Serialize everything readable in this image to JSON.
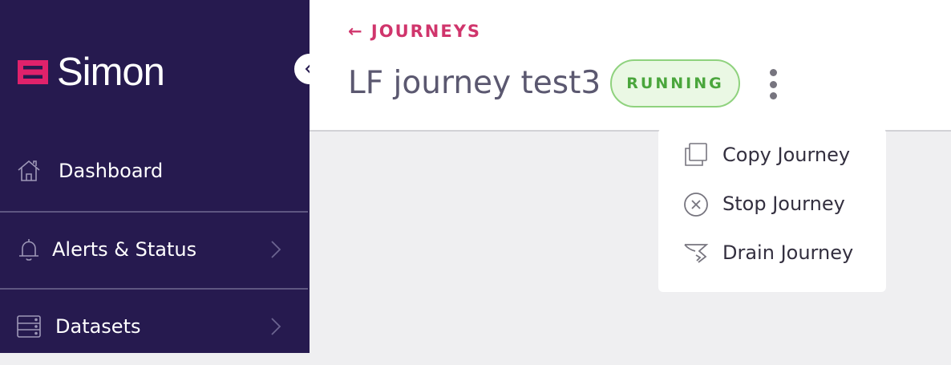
{
  "sidebar": {
    "brand": "Simon",
    "items": [
      {
        "label": "Dashboard",
        "icon": "home-icon"
      },
      {
        "label": "Alerts & Status",
        "icon": "bell-icon"
      },
      {
        "label": "Datasets",
        "icon": "database-icon"
      }
    ]
  },
  "header": {
    "back_link": "← JOURNEYS",
    "title": "LF journey test3",
    "status": "RUNNING"
  },
  "menu": {
    "items": [
      {
        "label": "Copy Journey",
        "icon": "copy-icon"
      },
      {
        "label": "Stop Journey",
        "icon": "stop-circle-icon"
      },
      {
        "label": "Drain Journey",
        "icon": "drain-icon"
      }
    ]
  },
  "colors": {
    "sidebar_bg": "#261a4f",
    "brand_accent": "#e0226b",
    "link": "#d0356c",
    "status_green": "#4aa63c",
    "content_bg": "#efeff1"
  }
}
